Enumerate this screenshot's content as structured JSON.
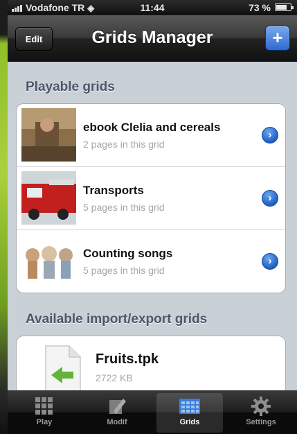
{
  "status_bar": {
    "carrier": "Vodafone TR",
    "time": "11:44",
    "battery": "73 %",
    "battery_level": 0.73
  },
  "nav": {
    "title": "Grids Manager",
    "edit_label": "Edit",
    "add_label": "+"
  },
  "sections": {
    "playable_header": "Playable grids",
    "import_header": "Available import/export grids"
  },
  "playable_grids": [
    {
      "title": "ebook Clelia and cereals",
      "subtitle": "2 pages in this grid"
    },
    {
      "title": "Transports",
      "subtitle": "5 pages in this grid"
    },
    {
      "title": "Counting songs",
      "subtitle": "5 pages in this grid"
    }
  ],
  "import_files": [
    {
      "title": "Fruits.tpk",
      "subtitle": "2722 KB"
    }
  ],
  "tabs": [
    {
      "label": "Play",
      "icon": "grid-icon",
      "active": false
    },
    {
      "label": "Modif",
      "icon": "pencil-icon",
      "active": false
    },
    {
      "label": "Grids",
      "icon": "grids-icon",
      "active": true
    },
    {
      "label": "Settings",
      "icon": "gear-icon",
      "active": false
    }
  ],
  "colors": {
    "accent": "#2f6ad0",
    "section_text": "#4b566a",
    "background": "#c9d0d6"
  }
}
